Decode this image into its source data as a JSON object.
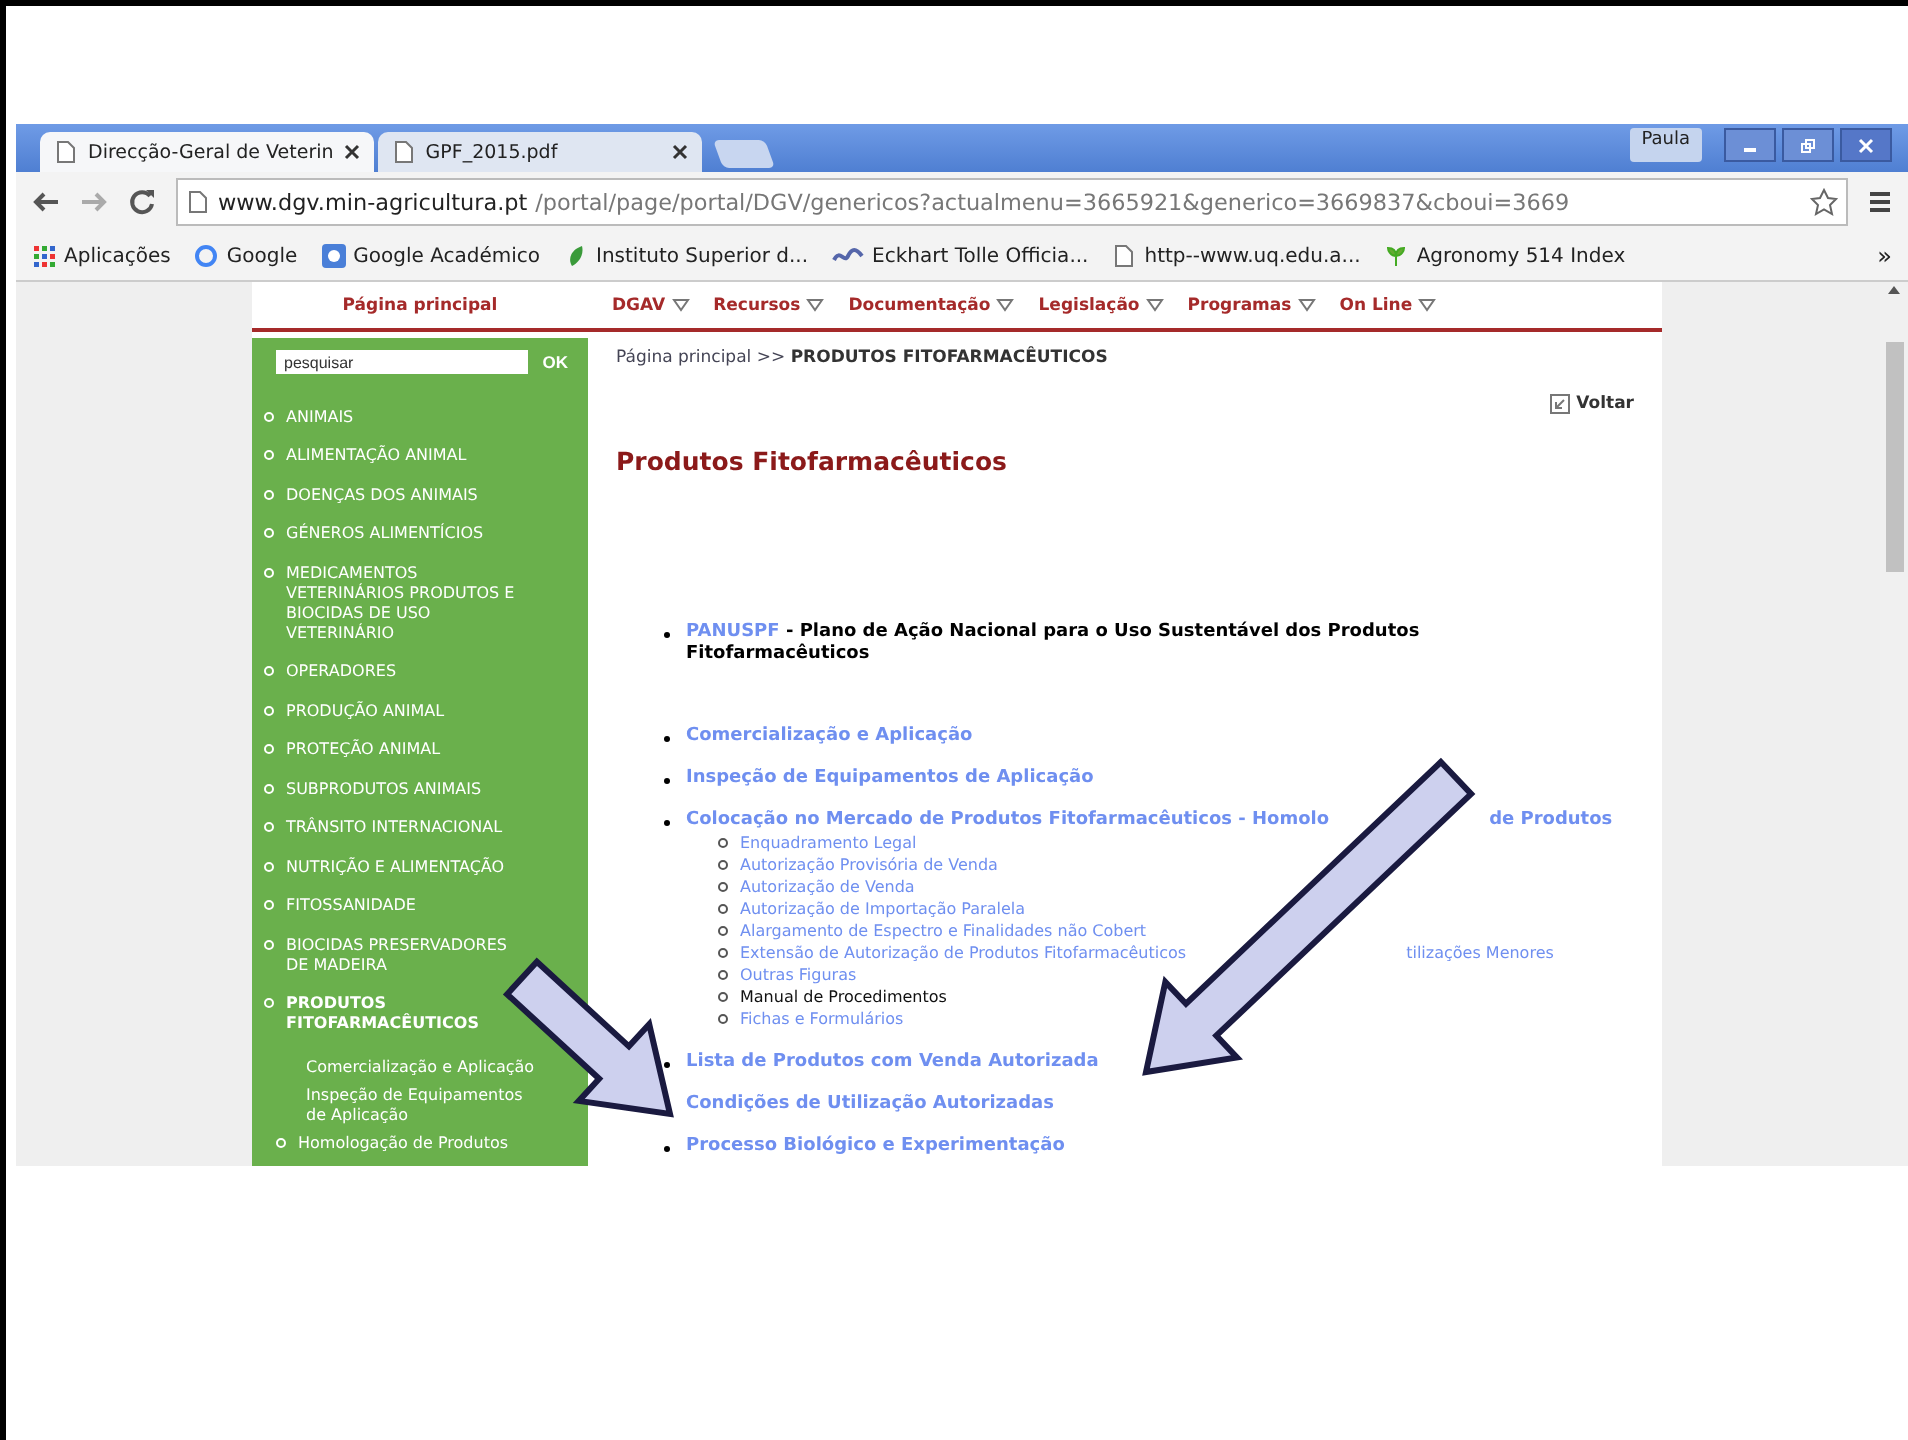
{
  "browser": {
    "tabs": [
      {
        "title": "Direcção-Geral de Veterin",
        "selected": true
      },
      {
        "title": "GPF_2015.pdf",
        "selected": false
      }
    ],
    "user": "Paula",
    "address": {
      "domain": "www.dgv.min-agricultura.pt",
      "path": "/portal/page/portal/DGV/genericos?actualmenu=3665921&generico=3669837&cboui=3669"
    },
    "bookmarks": [
      {
        "label": "Aplicações",
        "kind": "apps"
      },
      {
        "label": "Google",
        "kind": "google"
      },
      {
        "label": "Google Académico",
        "kind": "scholar"
      },
      {
        "label": "Instituto Superior d...",
        "kind": "leaf"
      },
      {
        "label": "Eckhart Tolle  Officia...",
        "kind": "wave"
      },
      {
        "label": "http--www.uq.edu.a...",
        "kind": "page"
      },
      {
        "label": "Agronomy 514 Index",
        "kind": "plant"
      }
    ],
    "more": "»"
  },
  "page": {
    "home_link": "Página principal",
    "nav": [
      "DGAV",
      "Recursos",
      "Documentação",
      "Legislação",
      "Programas",
      "On Line"
    ],
    "search": {
      "placeholder": "pesquisar",
      "button": "OK"
    },
    "sidebar": [
      {
        "label": "ANIMAIS",
        "selected": false
      },
      {
        "label": "ALIMENTAÇÃO ANIMAL",
        "selected": false
      },
      {
        "label": "DOENÇAS DOS ANIMAIS",
        "selected": false
      },
      {
        "label": "GÉNEROS ALIMENTÍCIOS",
        "selected": false
      },
      {
        "label": "MEDICAMENTOS VETERINÁRIOS PRODUTOS E BIOCIDAS DE USO VETERINÁRIO",
        "selected": false
      },
      {
        "label": "OPERADORES",
        "selected": false
      },
      {
        "label": "PRODUÇÃO ANIMAL",
        "selected": false
      },
      {
        "label": "PROTEÇÃO ANIMAL",
        "selected": false
      },
      {
        "label": "SUBPRODUTOS ANIMAIS",
        "selected": false
      },
      {
        "label": "TRÂNSITO INTERNACIONAL",
        "selected": false
      },
      {
        "label": "NUTRIÇÃO E ALIMENTAÇÃO",
        "selected": false
      },
      {
        "label": "FITOSSANIDADE",
        "selected": false
      },
      {
        "label": "BIOCIDAS PRESERVADORES DE MADEIRA",
        "selected": false
      },
      {
        "label": "PRODUTOS FITOFARMACÊUTICOS",
        "selected": true,
        "children": [
          {
            "label": "Comercialização e Aplicação",
            "kind": "plain"
          },
          {
            "label": "Inspeção de Equipamentos de Aplicação",
            "kind": "plain"
          },
          {
            "label": "Homologação de Produtos",
            "kind": "bullet"
          }
        ]
      }
    ],
    "breadcrumb": {
      "home": "Página principal",
      "separator": ">>",
      "current": "PRODUTOS FITOFARMACÊUTICOS"
    },
    "back_link": "Voltar",
    "heading": "Produtos Fitofarmacêuticos",
    "sections": [
      {
        "parts": [
          "PANUSPF"
        ],
        "description": "- Plano de Ação Nacional para o Uso Sustentável dos Produtos Fitofarmacêuticos"
      },
      {
        "parts": [
          "Comercialização e Aplicação"
        ]
      },
      {
        "parts": [
          "Inspeção de Equipamentos de Aplicação"
        ]
      },
      {
        "parts": [
          "Colocação no Mercado de Produtos Fitofarmacêuticos - Homolo",
          "de Produtos"
        ],
        "children": [
          {
            "parts": [
              "Enquadramento Legal"
            ],
            "selected": false
          },
          {
            "parts": [
              "Autorização Provisória de Venda"
            ],
            "selected": false
          },
          {
            "parts": [
              "Autorização de Venda"
            ],
            "selected": false
          },
          {
            "parts": [
              "Autorização de Importação Paralela"
            ],
            "selected": false
          },
          {
            "parts": [
              "Alargamento de Espectro e Finalidades não Cobert"
            ],
            "selected": false
          },
          {
            "parts": [
              "Extensão de Autorização de Produtos Fitofarmacêuticos",
              "tilizações Menores"
            ],
            "selected": false
          },
          {
            "parts": [
              "Outras Figuras"
            ],
            "selected": false
          },
          {
            "parts": [
              "Manual de Procedimentos"
            ],
            "selected": true
          },
          {
            "parts": [
              "Fichas e Formulários"
            ],
            "selected": false
          }
        ]
      },
      {
        "parts": [
          "Lista de Produtos com Venda Autorizada"
        ]
      },
      {
        "parts": [
          "Condições de Utilização Autorizadas"
        ]
      },
      {
        "parts": [
          "Processo Biológico e Experimentação"
        ]
      }
    ]
  }
}
